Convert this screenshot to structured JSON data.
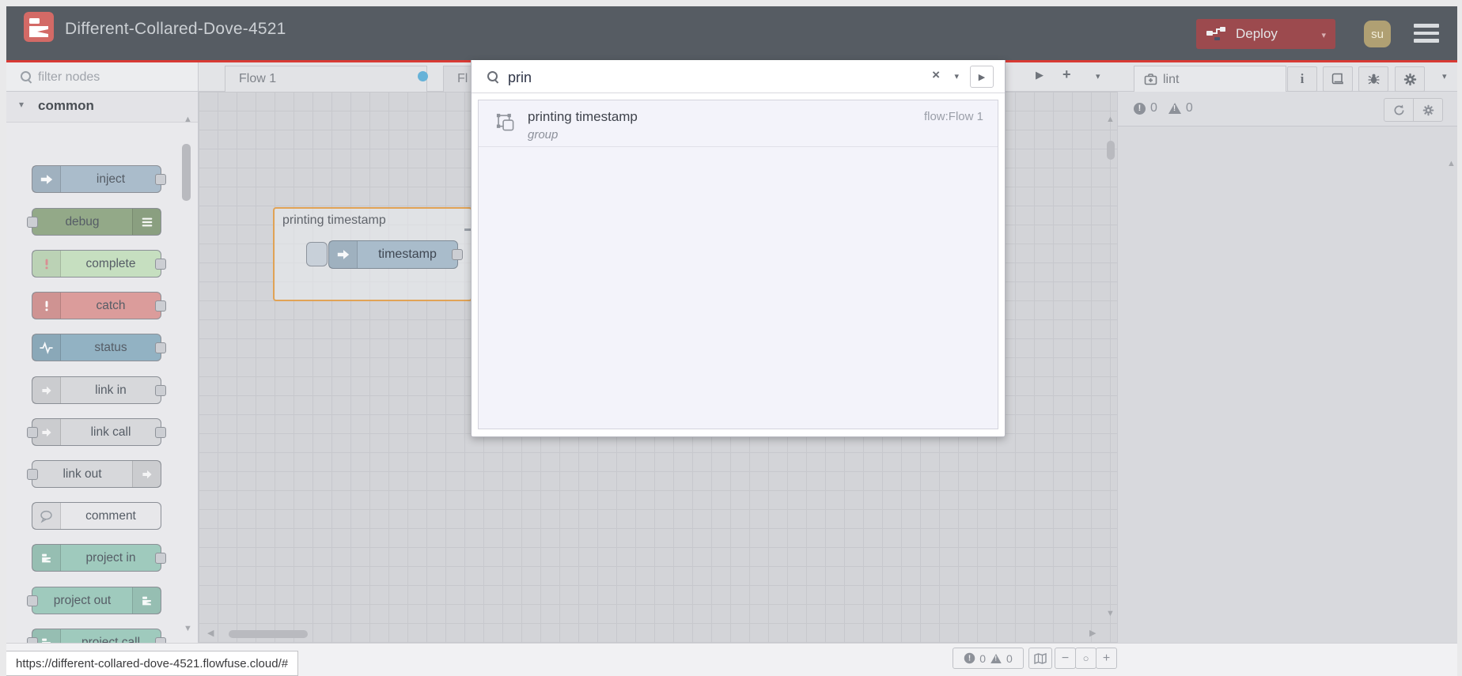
{
  "header": {
    "app_title": "Different-Collared-Dove-4521",
    "deploy_label": "Deploy",
    "avatar_initials": "su",
    "colors": {
      "header_bg": "#565c63",
      "accent_red": "#d83a34",
      "deploy_bg": "#9c4a4e",
      "logo_red": "#d36a66",
      "avatar_bg": "#b0a073"
    }
  },
  "palette": {
    "filter_placeholder": "filter nodes",
    "category_label": "common",
    "nodes": [
      {
        "label": "inject",
        "color": "#aabccb",
        "icon": "arrow-in",
        "icon_side": "left",
        "ports": [
          "right"
        ]
      },
      {
        "label": "debug",
        "color": "#93a988",
        "icon": "list",
        "icon_side": "right",
        "ports": [
          "left"
        ]
      },
      {
        "label": "complete",
        "color": "#c6dfc0",
        "icon": "alert",
        "icon_color": "#d98f94",
        "icon_side": "left",
        "ports": [
          "right"
        ]
      },
      {
        "label": "catch",
        "color": "#db9c9b",
        "icon": "alert",
        "icon_color": "#ffffff",
        "icon_side": "left",
        "ports": [
          "right"
        ]
      },
      {
        "label": "status",
        "color": "#92b2c3",
        "icon": "status",
        "icon_side": "left",
        "ports": [
          "right"
        ]
      },
      {
        "label": "link in",
        "color": "#d7d8db",
        "icon": "link",
        "icon_side": "left",
        "ports": [
          "right"
        ]
      },
      {
        "label": "link call",
        "color": "#d7d8db",
        "icon": "link",
        "icon_side": "left",
        "ports": [
          "left",
          "right"
        ]
      },
      {
        "label": "link out",
        "color": "#d7d8db",
        "icon": "link",
        "icon_side": "right",
        "ports": [
          "left"
        ]
      },
      {
        "label": "comment",
        "color": "#e7e7ea",
        "icon": "comment",
        "icon_color": "#9aa0a7",
        "icon_side": "left",
        "ports": []
      },
      {
        "label": "project in",
        "color": "#9fcabd",
        "icon": "nr-logo",
        "icon_side": "left",
        "ports": [
          "right"
        ]
      },
      {
        "label": "project out",
        "color": "#9fcabd",
        "icon": "nr-logo",
        "icon_side": "right",
        "ports": [
          "left"
        ]
      },
      {
        "label": "project call",
        "color": "#9fcabd",
        "icon": "nr-logo",
        "icon_side": "left",
        "ports": [
          "left",
          "right"
        ]
      }
    ]
  },
  "workspace": {
    "tabs": [
      {
        "label": "Flow 1",
        "active": true,
        "unsaved": true
      },
      {
        "label": "Fl",
        "active": false,
        "unsaved": false
      }
    ],
    "group": {
      "label": "printing timestamp",
      "node_label": "timestamp"
    }
  },
  "search": {
    "query": "prin",
    "results": [
      {
        "title": "printing timestamp",
        "meta": "flow:Flow 1",
        "subtitle": "group"
      }
    ]
  },
  "sidebar": {
    "tab_label": "lint",
    "error_count": "0",
    "warning_count": "0"
  },
  "canvas_footer": {
    "error_count": "0",
    "warning_count": "0"
  },
  "statusbar": {
    "url": "https://different-collared-dove-4521.flowfuse.cloud/#"
  }
}
